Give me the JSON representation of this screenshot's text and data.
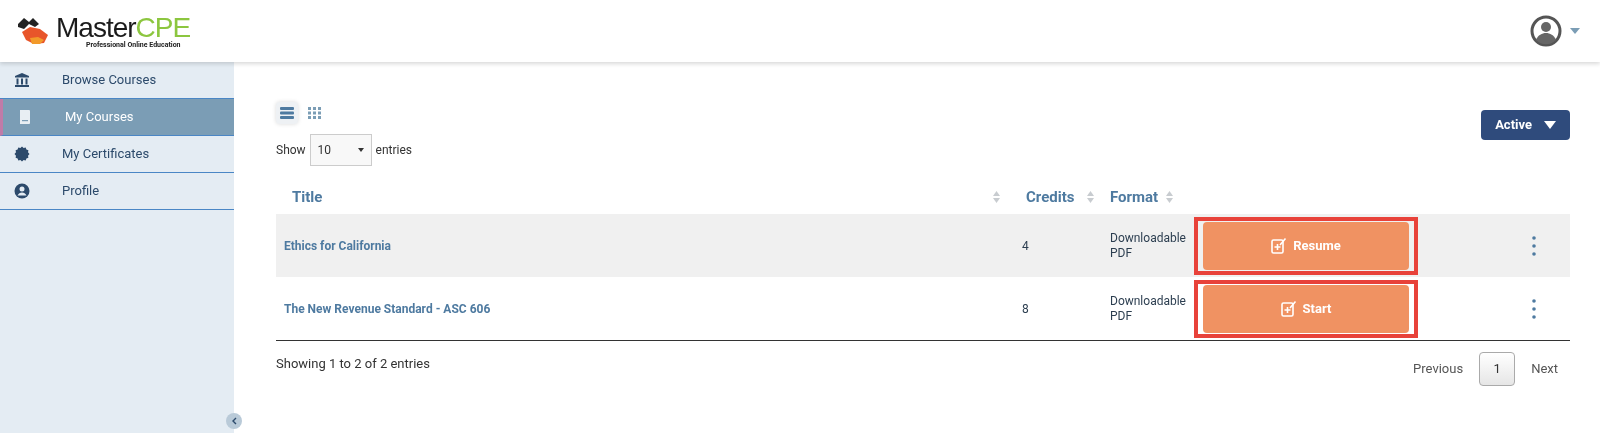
{
  "logo": {
    "name_dark": "Master",
    "name_accent": "CPE",
    "tagline": "Professional Online Education"
  },
  "sidebar": {
    "items": [
      {
        "label": "Browse Courses",
        "selected": false
      },
      {
        "label": "My Courses",
        "selected": true
      },
      {
        "label": "My Certificates",
        "selected": false
      },
      {
        "label": "Profile",
        "selected": false
      }
    ]
  },
  "view_toggle": [
    {
      "kind": "list",
      "selected": true
    },
    {
      "kind": "grid",
      "selected": false
    }
  ],
  "length": {
    "before": "Show",
    "value": "10",
    "after": "entries"
  },
  "status_filter": {
    "label": "Active"
  },
  "table": {
    "columns": [
      {
        "label": "Title"
      },
      {
        "label": "Credits"
      },
      {
        "label": "Format"
      }
    ],
    "rows": [
      {
        "title": "Ethics for California",
        "credits": "4",
        "format": "Downloadable PDF",
        "action": "Resume",
        "highlighted": true
      },
      {
        "title": "The New Revenue Standard - ASC 606",
        "credits": "8",
        "format": "Downloadable PDF",
        "action": "Start",
        "highlighted": true
      }
    ]
  },
  "info": "Showing 1 to 2 of 2 entries",
  "pagination": {
    "previous": "Previous",
    "pages": [
      {
        "label": "1",
        "selected": true
      }
    ],
    "next": "Next"
  }
}
